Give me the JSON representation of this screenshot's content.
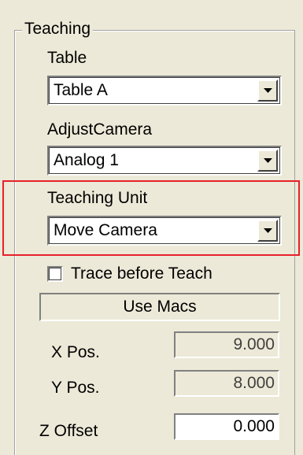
{
  "group": {
    "title": "Teaching"
  },
  "table": {
    "label": "Table",
    "value": "Table A"
  },
  "adjust_camera": {
    "label": "AdjustCamera",
    "value": "Analog 1"
  },
  "teaching_unit": {
    "label": "Teaching Unit",
    "value": "Move Camera"
  },
  "trace_before_teach": {
    "label": "Trace before Teach",
    "checked": false
  },
  "use_macs_button": {
    "label": "Use Macs"
  },
  "x_pos": {
    "label": "X Pos.",
    "value": "9.000"
  },
  "y_pos": {
    "label": "Y Pos.",
    "value": "8.000"
  },
  "z_offset": {
    "label": "Z Offset",
    "value": "0.000"
  },
  "colors": {
    "highlight_border": "#e8202a",
    "panel_bg": "#ece9d8"
  },
  "icons": {
    "dropdown": "chevron-down-icon"
  }
}
